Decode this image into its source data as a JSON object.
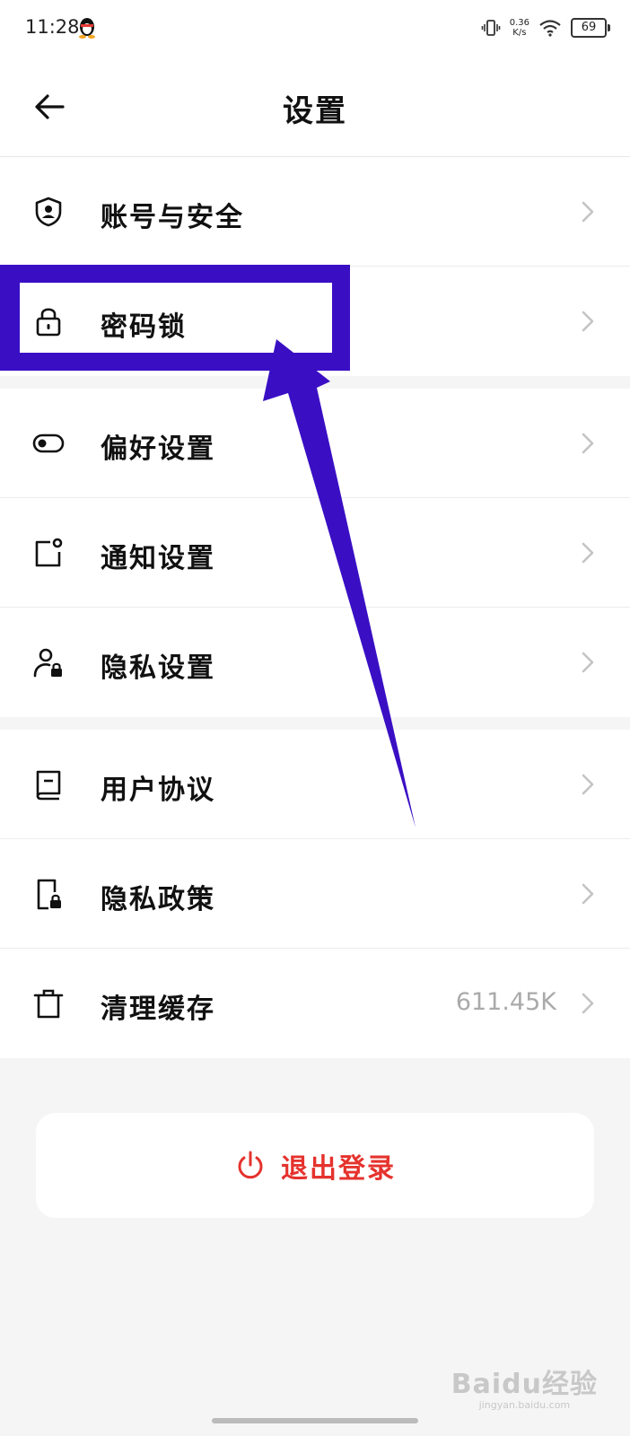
{
  "status_bar": {
    "time": "11:28",
    "net_speed_value": "0.36",
    "net_speed_unit": "K/s",
    "battery": "69"
  },
  "header": {
    "title": "设置"
  },
  "groups": [
    {
      "items": [
        {
          "label": "账号与安全",
          "icon": "shield-user-icon"
        },
        {
          "label": "密码锁",
          "icon": "lock-icon"
        }
      ]
    },
    {
      "items": [
        {
          "label": "偏好设置",
          "icon": "toggle-icon"
        },
        {
          "label": "通知设置",
          "icon": "notification-icon"
        },
        {
          "label": "隐私设置",
          "icon": "privacy-user-icon"
        }
      ]
    },
    {
      "items": [
        {
          "label": "用户协议",
          "icon": "book-icon"
        },
        {
          "label": "隐私政策",
          "icon": "privacy-doc-icon"
        },
        {
          "label": "清理缓存",
          "icon": "trash-icon",
          "value": "611.45K"
        }
      ]
    }
  ],
  "logout": {
    "label": "退出登录",
    "icon": "power-icon",
    "color": "#e5322d"
  },
  "annotation": {
    "color": "#3a0fc4"
  },
  "watermark": {
    "logo": "Baidu经验",
    "sub": "jingyan.baidu.com"
  }
}
